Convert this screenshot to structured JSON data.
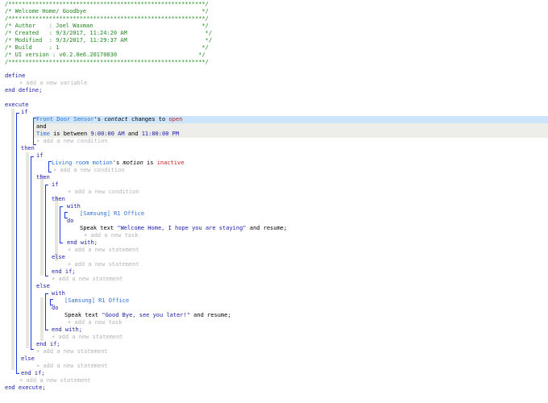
{
  "header": {
    "border": "/**********************************************************/",
    "title": "/* Welcome Home/ Goodbye                                  */",
    "author": "/* Author    : Joel Waxman                                */",
    "created": "/* Created   : 9/3/2017, 11:24:20 AM                       */",
    "modified": "/* Modified  : 9/3/2017, 11:29:37 AM                       */",
    "build": "/* Build     : 1                                          */",
    "ui_version": "/* UI version : v0.2.0e6.20170830                        */"
  },
  "code": {
    "define": "define",
    "add_variable": "+ add a new variable",
    "end_define": "end define;",
    "execute": "execute",
    "if": "if",
    "front_door": "Front Door Sensor",
    "s": "'s",
    "contact": "contact",
    "changes_to": "changes to",
    "open": "open",
    "and": "and",
    "time": "Time",
    "is_between": "is between",
    "time_start": "9:00:00 AM",
    "time_end": "11:00:00 PM",
    "add_condition": "+ add a new condition",
    "then": "then",
    "living_room": "Living room motion",
    "motion": "motion",
    "is": "is",
    "inactive": "inactive",
    "add_condition2": "+ add a new condition",
    "with": "with",
    "device_r1": "[Samsung] R1 Office",
    "do": "do",
    "speak_text": "Speak text",
    "msg_welcome": "\"Welcome Home, I hope you are staying\"",
    "and_resume": "and resume;",
    "add_task": "+ add a new task",
    "end_with": "end with;",
    "add_statement": "+ add a new statement",
    "else": "else",
    "end_if": "end if;",
    "msg_goodbye": "\"Good Bye, see you later!\"",
    "end_execute": "end execute;"
  },
  "colors": {
    "comment": "#228822",
    "keyword": "#1a1aa8",
    "device": "#2f6fd4",
    "value": "#c21f1f",
    "hint": "#b3b3b3",
    "bracket": "#1c3be0",
    "selected_row": "#cde5fb",
    "condition_bg": "#ededea",
    "indent_bar": "#e7e7dd"
  }
}
